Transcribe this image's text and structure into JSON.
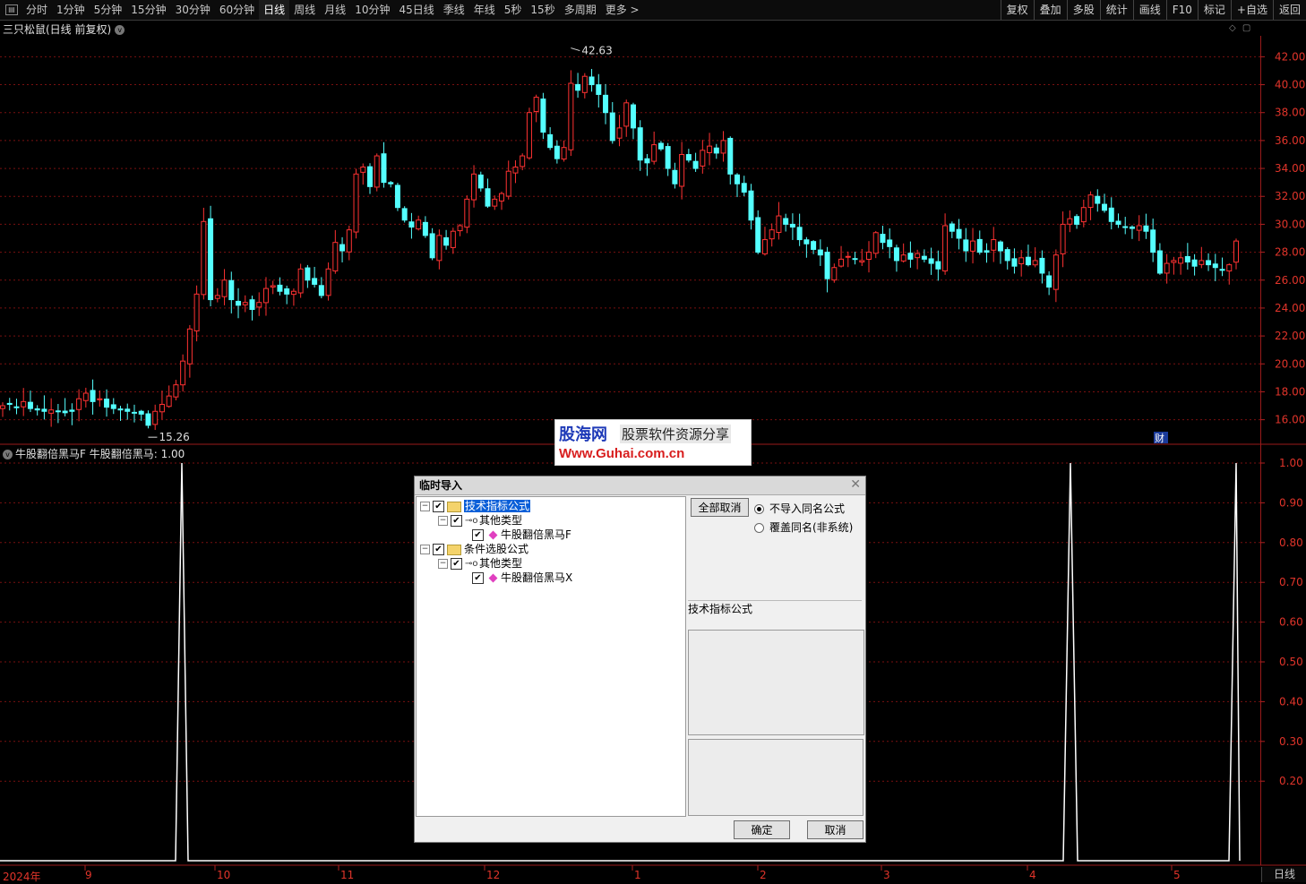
{
  "toolbar": {
    "periods": [
      "分时",
      "1分钟",
      "5分钟",
      "15分钟",
      "30分钟",
      "60分钟",
      "日线",
      "周线",
      "月线",
      "10分钟",
      "45日线",
      "季线",
      "年线",
      "5秒",
      "15秒",
      "多周期",
      "更多 >"
    ],
    "active_period": "日线",
    "right_tools": [
      "复权",
      "叠加",
      "多股",
      "统计",
      "画线",
      "F10",
      "标记",
      "+自选",
      "返回"
    ]
  },
  "stock": {
    "title": "三只松鼠(日线 前复权)"
  },
  "indicator": {
    "title": "牛股翻倍黑马F  牛股翻倍黑马: 1.00"
  },
  "price_axis": {
    "ticks": [
      "42.00",
      "40.00",
      "38.00",
      "36.00",
      "34.00",
      "32.00",
      "30.00",
      "28.00",
      "26.00",
      "24.00",
      "22.00",
      "20.00",
      "18.00",
      "16.00"
    ],
    "max_label": "42.63",
    "min_label": "15.26",
    "fin_badge": "财"
  },
  "indicator_axis": {
    "ticks": [
      "1.00",
      "0.90",
      "0.80",
      "0.70",
      "0.60",
      "0.50",
      "0.40",
      "0.30",
      "0.20"
    ]
  },
  "date_axis": {
    "labels": [
      "2024年",
      "9",
      "10",
      "11",
      "12",
      "1",
      "2",
      "3",
      "4",
      "5"
    ],
    "period_label": "日线"
  },
  "colors": {
    "up": "#ff3232",
    "down": "#54ffff",
    "grid": "#7a1010",
    "axis_text": "#e0342a",
    "indicator": "#ffffff"
  },
  "watermark": {
    "logo": "股海网",
    "slogan": "股票软件资源分享",
    "url": "Www.Guhai.com.cn"
  },
  "dialog": {
    "title": "临时导入",
    "tree": [
      {
        "label": "技术指标公式",
        "level": 0,
        "selected": true
      },
      {
        "label": "其他类型",
        "level": 1
      },
      {
        "label": "牛股翻倍黑马F",
        "level": 2
      },
      {
        "label": "条件选股公式",
        "level": 0
      },
      {
        "label": "其他类型",
        "level": 1
      },
      {
        "label": "牛股翻倍黑马X",
        "level": 2
      }
    ],
    "cancel_all": "全部取消",
    "option_no_import": "不导入同名公式",
    "option_overwrite": "覆盖同名(非系统)",
    "info_label": "技术指标公式",
    "ok": "确定",
    "cancel": "取消"
  },
  "chart_data": [
    {
      "type": "candlestick",
      "title": "三只松鼠(日线 前复权)",
      "ylim": [
        14.5,
        43.5
      ],
      "y_ticks": [
        16,
        18,
        20,
        22,
        24,
        26,
        28,
        30,
        32,
        34,
        36,
        38,
        40,
        42
      ],
      "max_marker": 42.63,
      "min_marker": 15.26,
      "closes": [
        17.0,
        17.1,
        16.9,
        17.3,
        16.8,
        16.7,
        16.6,
        16.7,
        16.6,
        16.5,
        16.6,
        17.5,
        17.9,
        17.3,
        17.5,
        16.9,
        16.8,
        16.7,
        16.6,
        16.5,
        16.4,
        15.6,
        16.6,
        17.1,
        17.7,
        18.5,
        20.2,
        22.5,
        25.0,
        30.2,
        24.6,
        24.9,
        26.0,
        24.6,
        24.2,
        24.4,
        23.9,
        24.4,
        25.4,
        25.6,
        25.2,
        25.0,
        25.2,
        26.8,
        26.0,
        25.7,
        24.9,
        26.8,
        28.7,
        28.1,
        29.6,
        33.6,
        34.1,
        32.7,
        34.9,
        33.0,
        32.9,
        31.2,
        30.3,
        29.8,
        30.3,
        29.2,
        27.6,
        29.2,
        28.5,
        29.5,
        29.9,
        31.8,
        33.6,
        32.6,
        31.3,
        31.8,
        32.2,
        33.8,
        34.1,
        34.9,
        38.0,
        39.1,
        36.6,
        35.5,
        34.7,
        35.5,
        40.1,
        39.6,
        40.6,
        40.0,
        39.3,
        38.0,
        36.0,
        36.9,
        38.7,
        36.9,
        34.6,
        34.4,
        35.7,
        35.4,
        34.0,
        32.9,
        35.0,
        34.6,
        34.0,
        35.3,
        35.6,
        35.1,
        36.0,
        33.6,
        32.9,
        32.3,
        30.3,
        28.0,
        28.9,
        29.6,
        30.6,
        30.0,
        29.8,
        28.9,
        28.6,
        28.2,
        27.8,
        26.1,
        26.9,
        27.5,
        27.7,
        27.5,
        27.4,
        28.0,
        29.4,
        28.7,
        28.4,
        27.4,
        27.8,
        27.5,
        27.9,
        27.5,
        27.2,
        26.8,
        29.9,
        29.5,
        29.0,
        28.1,
        28.8,
        28.0,
        28.0,
        28.9,
        28.1,
        27.4,
        27.0,
        27.6,
        27.1,
        27.4,
        26.5,
        25.5,
        27.8,
        30.0,
        30.4,
        30.0,
        31.2,
        32.1,
        31.5,
        31.0,
        30.2,
        30.0,
        29.8,
        29.7,
        29.9,
        29.5,
        28.0,
        26.5,
        27.2,
        27.4,
        27.6,
        27.3,
        27.0,
        27.4,
        27.1,
        26.9,
        26.7,
        27.1,
        28.8
      ]
    },
    {
      "type": "line",
      "series": [
        {
          "name": "牛股翻倍黑马",
          "spikes_at_dates": [
            "2024-09 end",
            "2025-04",
            "2025-05"
          ],
          "value_range": [
            0,
            1.0
          ]
        }
      ]
    }
  ]
}
